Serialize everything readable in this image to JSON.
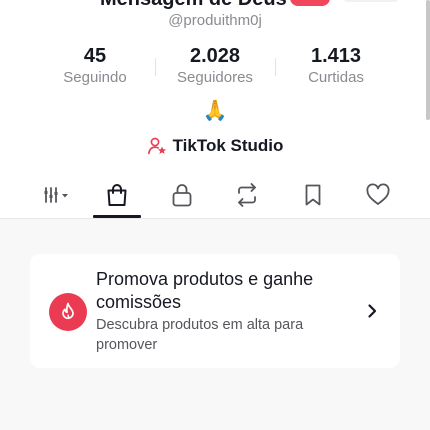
{
  "profile": {
    "display_name": "Mensagem de Deus",
    "handle": "@produithm0j",
    "bio": "🙏"
  },
  "stats": [
    {
      "value": "45",
      "label": "Seguindo"
    },
    {
      "value": "2.028",
      "label": "Seguidores"
    },
    {
      "value": "1.413",
      "label": "Curtidas"
    }
  ],
  "studio": {
    "label": "TikTok Studio"
  },
  "tabs": [
    {
      "icon": "filter-grid-icon",
      "selected": false
    },
    {
      "icon": "shopping-bag-icon",
      "selected": true
    },
    {
      "icon": "lock-icon",
      "selected": false
    },
    {
      "icon": "repost-icon",
      "selected": false
    },
    {
      "icon": "bookmark-icon",
      "selected": false
    },
    {
      "icon": "heart-icon",
      "selected": false
    }
  ],
  "promo": {
    "title": "Promova produtos e ganhe comissões",
    "description": "Descubra produtos em alta para promover",
    "icon": "flame-icon"
  },
  "colors": {
    "accent": "#ea3b52",
    "text": "#161823",
    "secondary_text": "#8a8b91",
    "background": "#f8f8f8"
  }
}
